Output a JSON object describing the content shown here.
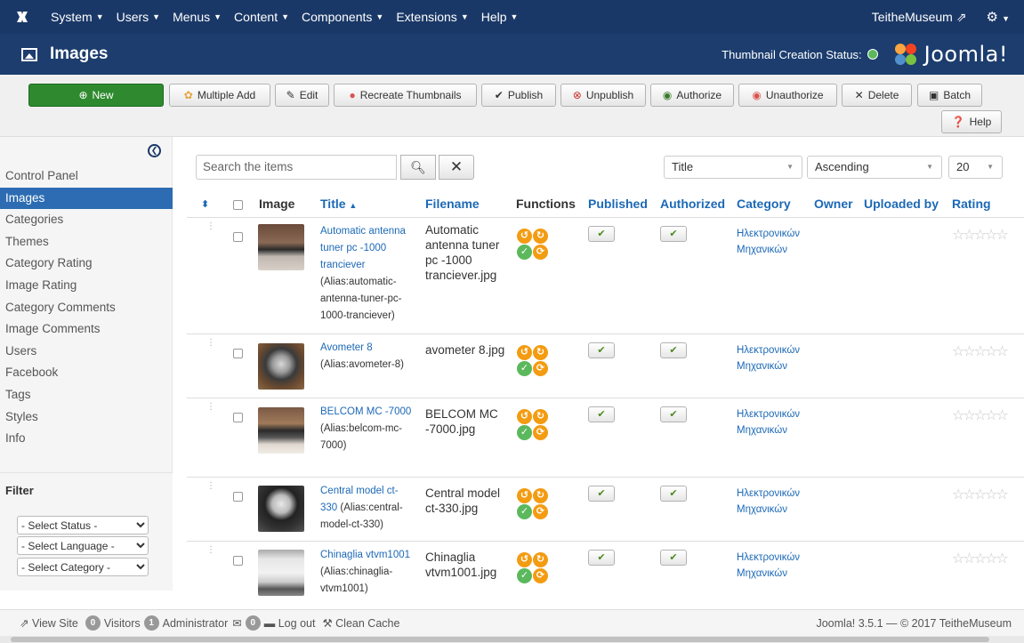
{
  "topbar": {
    "menus": [
      "System",
      "Users",
      "Menus",
      "Content",
      "Components",
      "Extensions",
      "Help"
    ],
    "site_name": "TeitheMuseum"
  },
  "header": {
    "title": "Images",
    "thumb_status_label": "Thumbnail Creation Status:",
    "brand": "Joomla!"
  },
  "toolbar": {
    "new": "New",
    "multiple_add": "Multiple Add",
    "edit": "Edit",
    "recreate": "Recreate Thumbnails",
    "publish": "Publish",
    "unpublish": "Unpublish",
    "authorize": "Authorize",
    "unauthorize": "Unauthorize",
    "delete": "Delete",
    "batch": "Batch",
    "help": "Help"
  },
  "sidebar": {
    "items": [
      "Control Panel",
      "Images",
      "Categories",
      "Themes",
      "Category Rating",
      "Image Rating",
      "Category Comments",
      "Image Comments",
      "Users",
      "Facebook",
      "Tags",
      "Styles",
      "Info"
    ],
    "active": "Images",
    "filter_title": "Filter",
    "filters": [
      "- Select Status -",
      "- Select Language -",
      "- Select Category -"
    ]
  },
  "search": {
    "placeholder": "Search the items",
    "sort_field": "Title",
    "sort_dir": "Ascending",
    "limit": "20"
  },
  "table": {
    "headers": {
      "image": "Image",
      "title": "Title",
      "filename": "Filename",
      "functions": "Functions",
      "published": "Published",
      "authorized": "Authorized",
      "category": "Category",
      "owner": "Owner",
      "uploaded_by": "Uploaded by",
      "rating": "Rating"
    },
    "rows": [
      {
        "title": "Automatic antenna tuner pc -1000 tranciever",
        "alias": "(Alias:automatic-antenna-tuner-pc-1000-tranciever)",
        "filename": "Automatic antenna tuner pc -1000 tranciever.jpg",
        "category": "Ηλεκτρονικών Μηχανικών"
      },
      {
        "title": "Avometer 8",
        "alias": "(Alias:avometer-8)",
        "filename": "avometer 8.jpg",
        "category": "Ηλεκτρονικών Μηχανικών"
      },
      {
        "title": "BELCOM MC -7000",
        "alias": "(Alias:belcom-mc-7000)",
        "filename": "BELCOM MC -7000.jpg",
        "category": "Ηλεκτρονικών Μηχανικών"
      },
      {
        "title": "Central model ct-330",
        "alias": "(Alias:central-model-ct-330)",
        "filename": "Central model ct-330.jpg",
        "category": "Ηλεκτρονικών Μηχανικών"
      },
      {
        "title": "Chinaglia vtvm1001",
        "alias": "(Alias:chinaglia-vtvm1001)",
        "filename": "Chinaglia vtvm1001.jpg",
        "category": "Ηλεκτρονικών Μηχανικών"
      }
    ]
  },
  "footer": {
    "view_site": "View Site",
    "visitors_count": "0",
    "visitors_label": "Visitors",
    "admin_count": "1",
    "admin_label": "Administrator",
    "messages_count": "0",
    "logout": "Log out",
    "clean_cache": "Clean Cache",
    "copyright": "Joomla! 3.5.1 — © 2017 TeitheMuseum"
  },
  "colors": {
    "navbar": "#1a3867",
    "header": "#1c3d6e",
    "new_button": "#2f8a2f",
    "active_item": "#2d6cb2",
    "link": "#1c69b6"
  }
}
